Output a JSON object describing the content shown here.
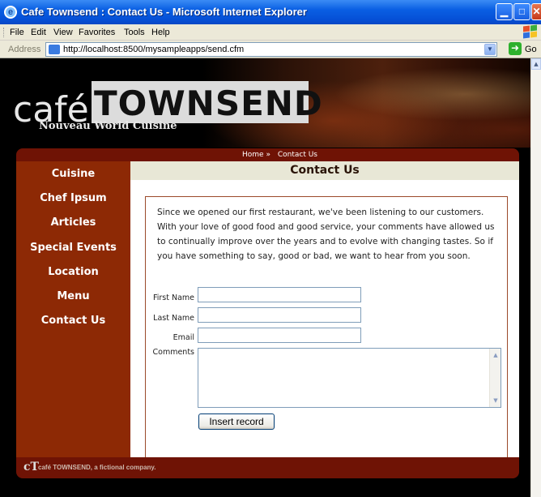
{
  "window": {
    "title": "Cafe Townsend : Contact Us - Microsoft Internet Explorer",
    "min_icon": "minimize-icon",
    "max_icon": "maximize-icon",
    "close_icon": "close-icon"
  },
  "menu": [
    "File",
    "Edit",
    "View",
    "Favorites",
    "Tools",
    "Help"
  ],
  "address": {
    "label": "Address",
    "url": "http://localhost:8500/mysampleapps/send.cfm",
    "go_label": "Go"
  },
  "banner": {
    "cafe": "café",
    "townsend": "TOWNSEND",
    "tagline": "Nouveau World Cuisine"
  },
  "breadcrumb": {
    "home": "Home »",
    "current": "Contact Us"
  },
  "nav": [
    "Cuisine",
    "Chef Ipsum",
    "Articles",
    "Special Events",
    "Location",
    "Menu",
    "Contact Us"
  ],
  "content": {
    "heading": "Contact Us",
    "intro": "Since we opened our first restaurant, we've been listening to our customers. With your love of good food and good service, your comments have allowed us to continually improve over the years and to evolve with changing tastes. So if you have something to say, good or bad, we want to hear from you soon."
  },
  "form": {
    "first_name_label": "First Name",
    "last_name_label": "Last Name",
    "email_label": "Email",
    "comments_label": "Comments",
    "first_name_value": "",
    "last_name_value": "",
    "email_value": "",
    "comments_value": "",
    "submit_label": "Insert record"
  },
  "footer": {
    "logo": "cT",
    "text": "café TOWNSEND, a fictional company."
  },
  "colors": {
    "sidebar": "#8d2905",
    "bar": "#6f1305",
    "header_bg": "#e8e7d6"
  }
}
